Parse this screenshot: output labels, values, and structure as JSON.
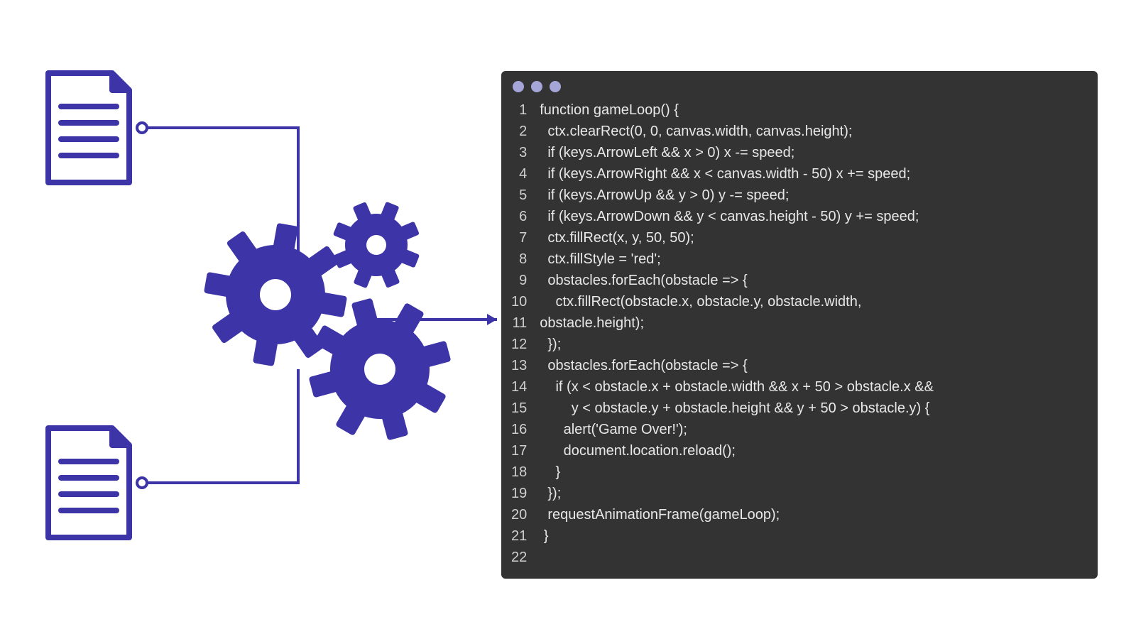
{
  "colors": {
    "accent": "#3c34a7",
    "codeBg": "#333333",
    "codeText": "#e8e8e8",
    "dot": "#a5a5d8"
  },
  "code": {
    "lines": [
      "function gameLoop() {",
      "  ctx.clearRect(0, 0, canvas.width, canvas.height);",
      "  if (keys.ArrowLeft && x > 0) x -= speed;",
      "  if (keys.ArrowRight && x < canvas.width - 50) x += speed;",
      "  if (keys.ArrowUp && y > 0) y -= speed;",
      "  if (keys.ArrowDown && y < canvas.height - 50) y += speed;",
      "  ctx.fillRect(x, y, 50, 50);",
      "  ctx.fillStyle = 'red';",
      "  obstacles.forEach(obstacle => {",
      "    ctx.fillRect(obstacle.x, obstacle.y, obstacle.width,",
      "obstacle.height);",
      "  });",
      "  obstacles.forEach(obstacle => {",
      "    if (x < obstacle.x + obstacle.width && x + 50 > obstacle.x &&",
      "        y < obstacle.y + obstacle.height && y + 50 > obstacle.y) {",
      "      alert('Game Over!');",
      "      document.location.reload();",
      "    }",
      "  });",
      "  requestAnimationFrame(gameLoop);",
      " }",
      ""
    ]
  }
}
